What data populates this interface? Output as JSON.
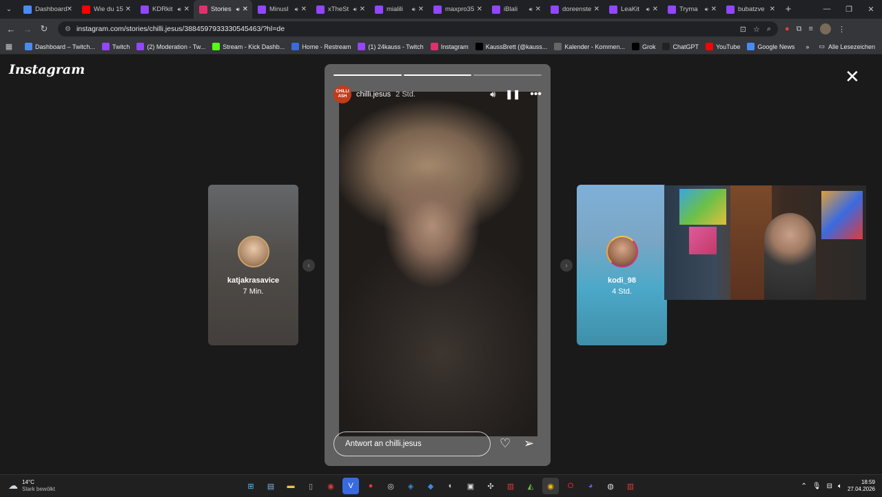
{
  "tabs": [
    {
      "title": "Dashboard",
      "fav": "#4a8af4",
      "audio": false,
      "active": false
    },
    {
      "title": "Wie du 15",
      "fav": "#ff0000",
      "audio": false,
      "active": false
    },
    {
      "title": "KDRkit",
      "fav": "#9146ff",
      "audio": true,
      "active": false
    },
    {
      "title": "Stories",
      "fav": "#e1306c",
      "audio": true,
      "active": true
    },
    {
      "title": "Minusl",
      "fav": "#9146ff",
      "audio": true,
      "active": false
    },
    {
      "title": "xTheSt",
      "fav": "#9146ff",
      "audio": true,
      "active": false
    },
    {
      "title": "mialili",
      "fav": "#9146ff",
      "audio": true,
      "active": false
    },
    {
      "title": "maxpro35",
      "fav": "#9146ff",
      "audio": false,
      "active": false
    },
    {
      "title": "iBlali",
      "fav": "#9146ff",
      "audio": true,
      "active": false
    },
    {
      "title": "doreenste",
      "fav": "#9146ff",
      "audio": false,
      "active": false
    },
    {
      "title": "LeaKit",
      "fav": "#9146ff",
      "audio": true,
      "active": false
    },
    {
      "title": "Tryma",
      "fav": "#9146ff",
      "audio": true,
      "active": false
    },
    {
      "title": "bubatzve",
      "fav": "#9146ff",
      "audio": false,
      "active": false
    }
  ],
  "address": {
    "url": "instagram.com/stories/chilli.jesus/3884597933330545463/?hl=de"
  },
  "bookmarks": [
    {
      "label": "Dashboard – Twitch...",
      "color": "#4a8af4"
    },
    {
      "label": "Twitch",
      "color": "#9146ff"
    },
    {
      "label": "(2) Moderation - Tw...",
      "color": "#9146ff"
    },
    {
      "label": "Stream - Kick Dashb...",
      "color": "#53fc18"
    },
    {
      "label": "Home - Restream",
      "color": "#3a6ae0"
    },
    {
      "label": "(1) 24kauss - Twitch",
      "color": "#9146ff"
    },
    {
      "label": "Instagram",
      "color": "#e1306c"
    },
    {
      "label": "KaussBrett (@kauss...",
      "color": "#000000"
    },
    {
      "label": "Kalender - Kommen...",
      "color": "#666666"
    },
    {
      "label": "Grok",
      "color": "#000000"
    },
    {
      "label": "ChatGPT",
      "color": "#222222"
    },
    {
      "label": "YouTube",
      "color": "#ff0000"
    },
    {
      "label": "Google News",
      "color": "#4a8af4"
    }
  ],
  "bookmarks_right": "Alle Lesezeichen",
  "instagram": {
    "logo": "Instagram",
    "story": {
      "avatar_text": "CHILLI ASH",
      "username": "chilli.jesus",
      "time": "2 Std.",
      "reply_placeholder": "Antwort an chilli.jesus",
      "progress": [
        1.0,
        1.0,
        0.0
      ]
    },
    "prev_story": {
      "username": "katjakrasavice",
      "time": "7 Min."
    },
    "next_story": {
      "username": "kodi_98",
      "time": "4 Std."
    }
  },
  "taskbar": {
    "weather_temp": "14°C",
    "weather_desc": "Stark bewölkt",
    "time": "18:59",
    "date": "27.04.2026"
  }
}
